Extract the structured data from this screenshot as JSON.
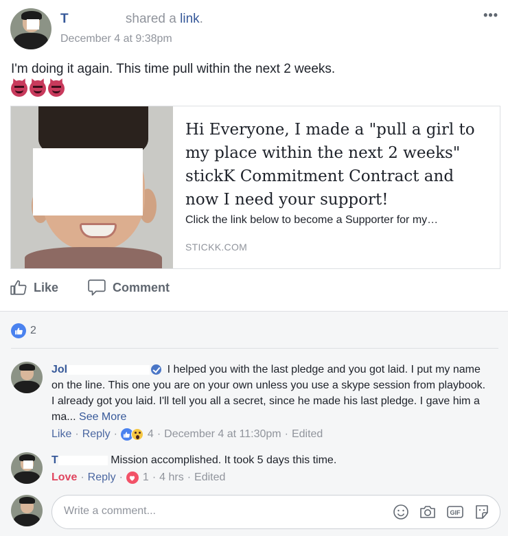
{
  "post": {
    "author_visible": "T",
    "shared_text": "shared a",
    "link_word": "link",
    "timestamp": "December 4 at 9:38pm",
    "more_glyph": "•••",
    "text": "I'm doing it again. This time pull within the next 2 weeks.",
    "emoji": [
      "smiling-devil",
      "smiling-devil",
      "smiling-devil"
    ]
  },
  "link_card": {
    "title": "Hi Everyone, I made a \"pull a girl to my place within the next 2 weeks\" stickK Commitment Contract and now I need your support!",
    "description": "Click the link below to become a Supporter for my…",
    "domain": "STICKK.COM"
  },
  "actions": {
    "like": "Like",
    "comment": "Comment"
  },
  "reactions": {
    "count": "2"
  },
  "comments": [
    {
      "author_visible": "Jol",
      "text": "I helped you with the last pledge and you got laid. I put my name on the line. This one you are on your own unless you use a skype session from playbook. I already got you laid. I'll tell you all a secret, since he made his last pledge. I gave him a ma...",
      "see_more": "See More",
      "like": "Like",
      "reply": "Reply",
      "reaction_count": "4",
      "timestamp": "December 4 at 11:30pm",
      "edited": "Edited"
    },
    {
      "author_visible": "T",
      "text": "Mission accomplished. It took 5 days this time.",
      "love": "Love",
      "reply": "Reply",
      "reaction_count": "1",
      "timestamp": "4 hrs",
      "edited": "Edited"
    }
  ],
  "composer": {
    "placeholder": "Write a comment...",
    "gif": "GIF"
  },
  "colors": {
    "link_blue": "#365899",
    "meta_grey": "#90949c",
    "like_blue": "#4a82ef",
    "love_red": "#e0445e",
    "comments_bg": "#f5f6f7"
  }
}
